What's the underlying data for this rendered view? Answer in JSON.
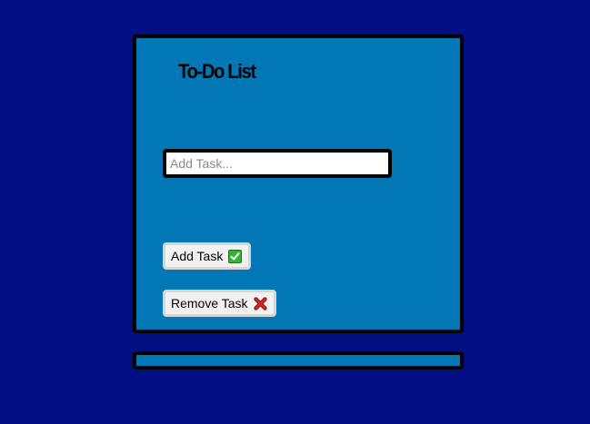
{
  "app": {
    "title": "To-Do List"
  },
  "input": {
    "placeholder": "Add Task...",
    "value": ""
  },
  "buttons": {
    "add_label": "Add Task",
    "add_icon": "check-mark-icon",
    "remove_label": "Remove Task",
    "remove_icon": "cross-mark-icon"
  },
  "task_list": {
    "items": []
  },
  "colors": {
    "page_background": "#000e82",
    "card_background": "#0277b5",
    "border": "#000000",
    "check_green": "#2fb52f",
    "cross_red": "#d11a1a"
  }
}
